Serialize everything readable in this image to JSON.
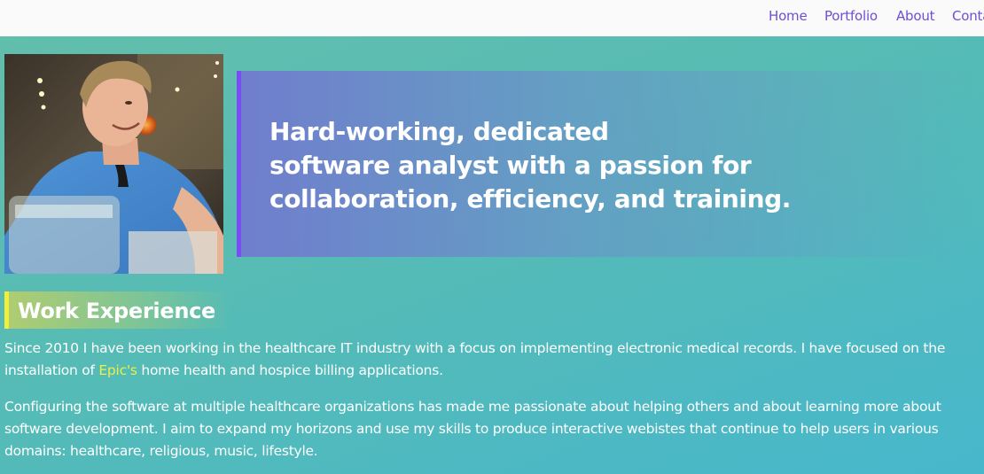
{
  "nav": {
    "links": [
      {
        "label": "Home"
      },
      {
        "label": "Portfolio"
      },
      {
        "label": "About"
      },
      {
        "label": "Contact"
      }
    ]
  },
  "hero": {
    "lines": [
      "Hard-working, dedicated",
      "software analyst with a passion for",
      "collaboration, efficiency, and training."
    ]
  },
  "work_experience": {
    "heading": "Work Experience",
    "paragraph1": {
      "before_link": "Since 2010 I have been working in the healthcare IT industry with a focus on implementing electronic medical records. I have focused on the installation of ",
      "link_text": "Epic's",
      "after_link": " home health and hospice billing applications."
    },
    "paragraph2": "Configuring the software at multiple healthcare organizations has made me passionate about helping others and about learning more about software development. I aim to expand my horizons and use my skills to produce interactive webistes that continue to help users in various domains: healthcare, religious, music, lifestyle."
  },
  "colors": {
    "nav_link": "#6f4fd1",
    "hero_accent": "#7b4cf5",
    "heading_accent": "#f3ee3a",
    "link_highlight": "#ecee4a"
  }
}
